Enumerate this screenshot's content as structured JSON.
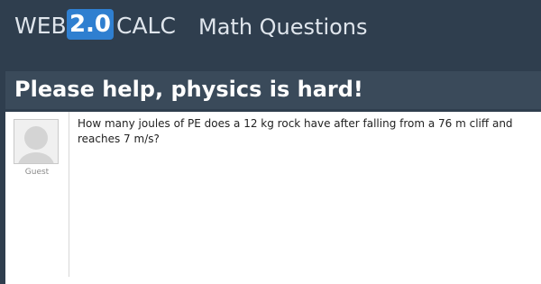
{
  "header": {
    "logo": {
      "web": "WEB",
      "version": "2.0",
      "calc": "CALC"
    },
    "section_title": "Math Questions"
  },
  "question": {
    "title": "Please help, physics is hard!",
    "author": "Guest",
    "body": "How many joules of PE does a 12 kg rock have after falling from a 76 m cliff and reaches 7 m/s?"
  },
  "colors": {
    "background": "#2f3e4e",
    "title_bar": "#3a4a5a",
    "logo_badge": "#2f7fd0",
    "content_bg": "#ffffff"
  },
  "icons": {
    "avatar": "user-placeholder-icon"
  }
}
